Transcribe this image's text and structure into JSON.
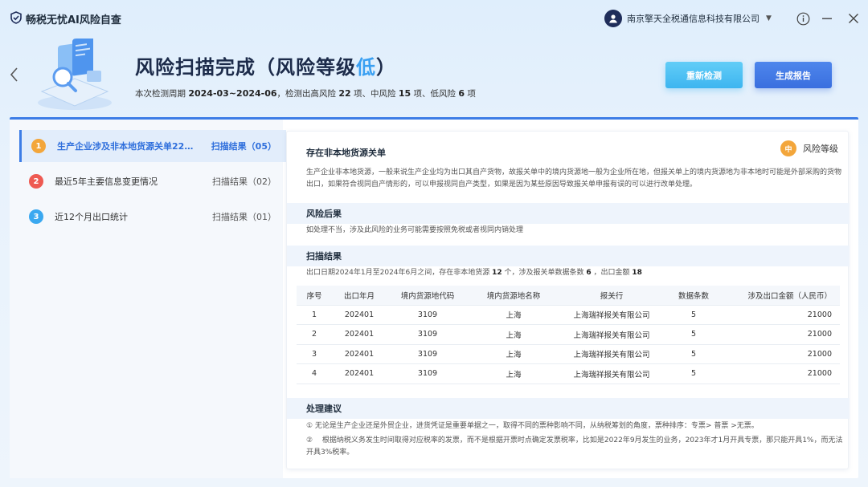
{
  "app": {
    "title": "畅税无忧AI风险自查"
  },
  "account": {
    "company": "南京擎天全税通信息科技有限公司"
  },
  "hero": {
    "title_prefix": "风险扫描完成（风险等级",
    "title_level": "低",
    "title_suffix": "）",
    "sub_1": "本次检测周期 ",
    "period": "2024-03~2024-06",
    "sub_2": "，检测出高风险 ",
    "high": "22",
    "sub_3": " 项、中风险 ",
    "mid": "15",
    "sub_4": " 项、低风险 ",
    "low": "6",
    "sub_5": " 项"
  },
  "buttons": {
    "recheck": "重新检测",
    "report": "生成报告"
  },
  "sidebar": {
    "items": [
      {
        "num": "1",
        "label": "生产企业涉及非本地货源关单221...",
        "result": "扫描结果（05）",
        "color": "#f3a63b"
      },
      {
        "num": "2",
        "label": "最近5年主要信息变更情况",
        "result": "扫描结果（02）",
        "color": "#ee5a52"
      },
      {
        "num": "3",
        "label": "近12个月出口统计",
        "result": "扫描结果（01）",
        "color": "#3aa8f0"
      }
    ]
  },
  "detail": {
    "title": "存在非本地货源关单",
    "risk_badge": "中",
    "risk_label": "风险等级",
    "description": "生产企业非本地货源，一般来说生产企业均为出口其自产货物，故报关单中的境内货源地一般为企业所在地，但报关单上的境内货源地为非本地时可能是外部采购的货物出口，如果符合视同自产情形的，可以申报视同自产类型，如果是因为某些原因导致报关单申报有误的可以进行改单处理。",
    "consequence_title": "风险后果",
    "consequence": "如处理不当，涉及此风险的业务可能需要按照免税或者视同内销处理",
    "scan_title": "扫描结果",
    "scan_1": "出口日期2024年1月至2024年6月之间，存在非本地货源 ",
    "scan_count": "12",
    "scan_2": " 个，涉及报关单数据条数 ",
    "scan_rows": "6",
    "scan_3": " ，出口金额 ",
    "scan_amount": "18",
    "table": {
      "headers": [
        "序号",
        "出口年月",
        "境内货源地代码",
        "境内货源地名称",
        "报关行",
        "数据条数",
        "涉及出口金额（人民币）"
      ],
      "rows": [
        [
          "1",
          "202401",
          "3109",
          "上海",
          "上海瑞祥报关有限公司",
          "5",
          "21000"
        ],
        [
          "2",
          "202401",
          "3109",
          "上海",
          "上海瑞祥报关有限公司",
          "5",
          "21000"
        ],
        [
          "3",
          "202401",
          "3109",
          "上海",
          "上海瑞祥报关有限公司",
          "5",
          "21000"
        ],
        [
          "4",
          "202401",
          "3109",
          "上海",
          "上海瑞祥报关有限公司",
          "5",
          "21000"
        ]
      ]
    },
    "advice_title": "处理建议",
    "advice_1": "① 无论是生产企业还是外贸企业，进货凭证是重要单据之一，取得不同的票种影响不同，从纳税筹划的角度，票种排序：专票> 普票 >无票。",
    "advice_2": "② 　根据纳税义务发生时间取得对应税率的发票，而不是根据开票时点确定发票税率，比如是2022年9月发生的业务，2023年才1月开具专票，那只能开具1%，而无法开具3%税率。"
  },
  "icons": {
    "app_logo": "shield-logo-icon",
    "avatar": "user-avatar-icon",
    "help": "help-circle-icon",
    "minimize": "minimize-icon",
    "close": "close-icon",
    "back": "chevron-left-icon"
  }
}
